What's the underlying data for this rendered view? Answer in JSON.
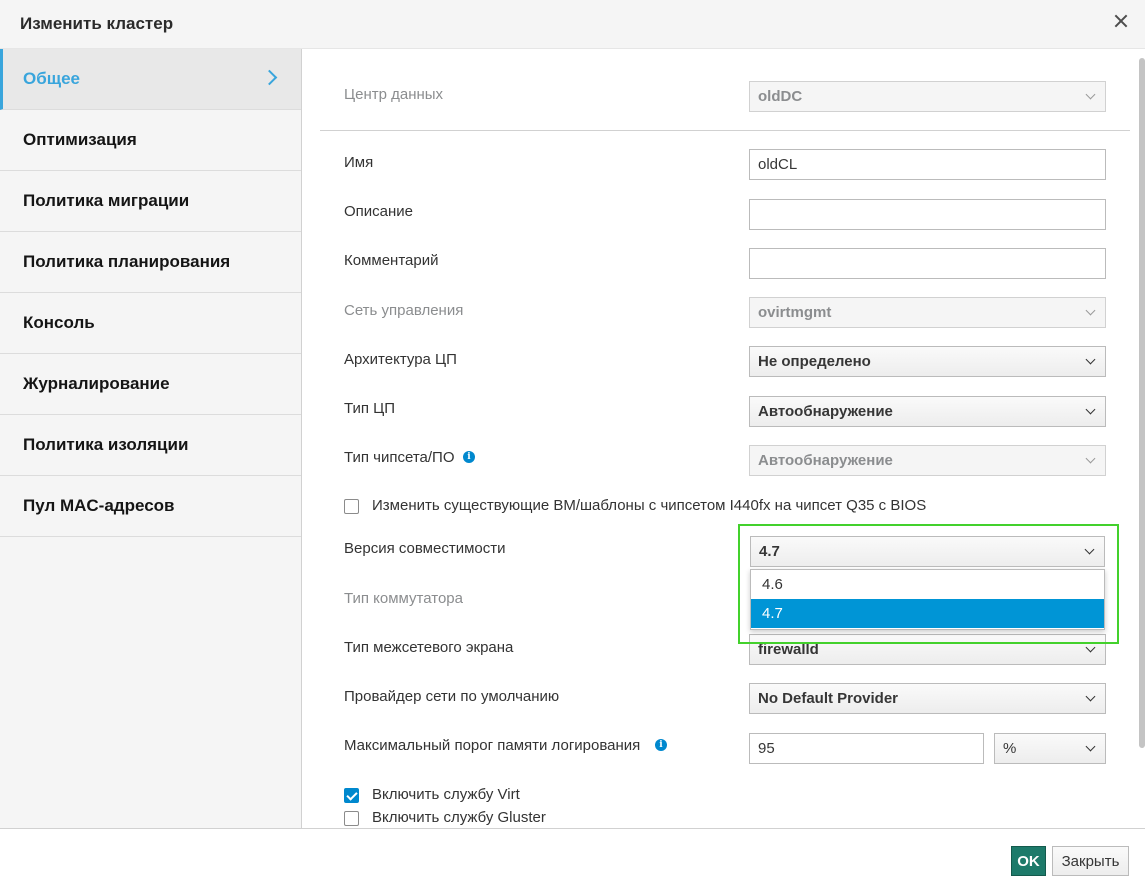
{
  "dialog": {
    "title": "Изменить кластер"
  },
  "sidebar": {
    "items": [
      {
        "label": "Общее"
      },
      {
        "label": "Оптимизация"
      },
      {
        "label": "Политика миграции"
      },
      {
        "label": "Политика планирования"
      },
      {
        "label": "Консоль"
      },
      {
        "label": "Журналирование"
      },
      {
        "label": "Политика изоляции"
      },
      {
        "label": "Пул MAC-адресов"
      }
    ],
    "active_index": 0
  },
  "form": {
    "data_center": {
      "label": "Центр данных",
      "value": "oldDC"
    },
    "name": {
      "label": "Имя",
      "value": "oldCL"
    },
    "description": {
      "label": "Описание",
      "value": ""
    },
    "comment": {
      "label": "Комментарий",
      "value": ""
    },
    "management_network": {
      "label": "Сеть управления",
      "value": "ovirtmgmt"
    },
    "cpu_architecture": {
      "label": "Архитектура ЦП",
      "value": "Не определено"
    },
    "cpu_type": {
      "label": "Тип ЦП",
      "value": "Автообнаружение"
    },
    "chipset": {
      "label": "Тип чипсета/ПО",
      "value": "Автообнаружение"
    },
    "change_chipset_checkbox": {
      "label": "Изменить существующие ВМ/шаблоны с чипсетом I440fx на чипсет Q35 с BIOS",
      "checked": false
    },
    "compat_version": {
      "label": "Версия совместимости",
      "value": "4.7",
      "options": [
        "4.6",
        "4.7"
      ],
      "selected_option": "4.7"
    },
    "switch_type": {
      "label": "Тип коммутатора"
    },
    "firewall_type": {
      "label": "Тип межсетевого экрана",
      "value": "firewalld"
    },
    "default_network_provider": {
      "label": "Провайдер сети по умолчанию",
      "value": "No Default Provider"
    },
    "log_max_memory": {
      "label": "Максимальный порог памяти логирования",
      "value": "95",
      "unit": "%"
    },
    "virt_service": {
      "label": "Включить службу Virt",
      "checked": true
    },
    "gluster_service": {
      "label": "Включить службу Gluster",
      "checked": false
    }
  },
  "footer": {
    "ok_label": "OK",
    "close_label": "Закрыть"
  },
  "colors": {
    "accent": "#39a5dc",
    "selected_option": "#0095d6",
    "ok_button": "#1d7a6a",
    "highlight_border": "#43d12c"
  },
  "icons": [
    "close-icon",
    "chevron-right-icon",
    "chevron-down-icon",
    "info-icon",
    "checkmark-icon"
  ]
}
